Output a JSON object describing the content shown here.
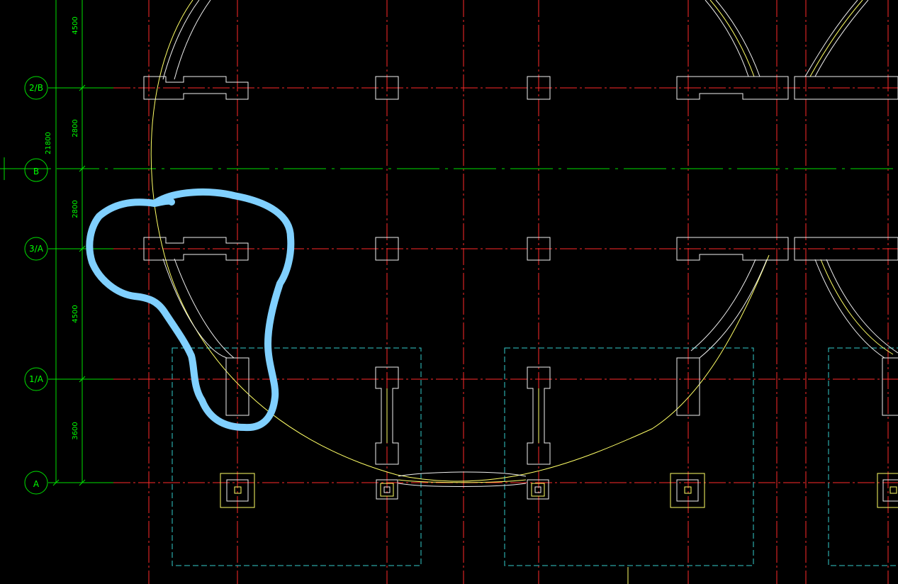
{
  "colors": {
    "background": "#000000",
    "grid_red": "#ff2a2a",
    "grid_green": "#00e000",
    "outline_white": "#f0f0f0",
    "yellow": "#ffff66",
    "cyan": "#33cccc",
    "annotation_blue": "#80d0ff"
  },
  "axes": [
    {
      "id": "2-B",
      "label": "2/B"
    },
    {
      "id": "B",
      "label": "B"
    },
    {
      "id": "3-A",
      "label": "3/A"
    },
    {
      "id": "1-A",
      "label": "1/A"
    },
    {
      "id": "A",
      "label": "A"
    }
  ],
  "dimensions": [
    {
      "id": "d4500-top",
      "label": "4500"
    },
    {
      "id": "d2800-a",
      "label": "2800"
    },
    {
      "id": "d21800",
      "label": "21800"
    },
    {
      "id": "d2800-b",
      "label": "2800"
    },
    {
      "id": "d4500-mid",
      "label": "4500"
    },
    {
      "id": "d3600",
      "label": "3600"
    }
  ],
  "annotation": {
    "shape": "freehand-loop",
    "color": "annotation_blue"
  }
}
